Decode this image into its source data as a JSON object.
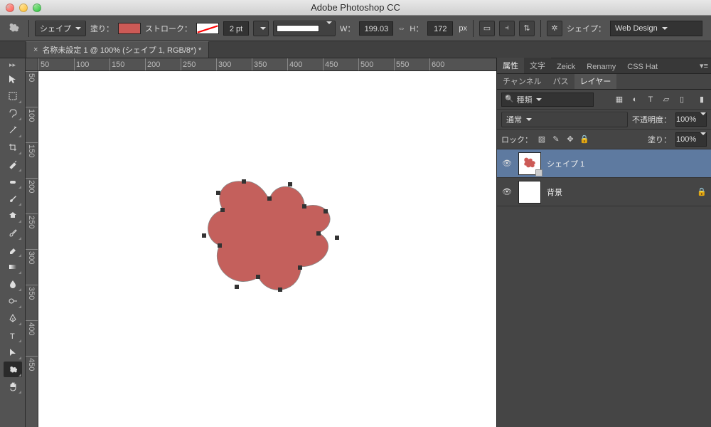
{
  "app_title": "Adobe Photoshop CC",
  "optbar": {
    "tool_mode": "シェイプ",
    "fill_label": "塗り：",
    "stroke_label": "ストローク：",
    "stroke_width": "2 pt",
    "w_label": "W：",
    "w_value": "199.03",
    "h_label": "H：",
    "h_value": "172",
    "h_unit": "px",
    "shape_label": "シェイプ：",
    "workspace": "Web Design"
  },
  "doc_tab": "名称未設定 1 @ 100% (シェイプ 1, RGB/8*) *",
  "ruler_h": [
    "50",
    "100",
    "150",
    "200",
    "250",
    "300",
    "350",
    "400",
    "450",
    "500",
    "550",
    "600"
  ],
  "ruler_v": [
    "50",
    "100",
    "150",
    "200",
    "250",
    "300",
    "350",
    "400",
    "450"
  ],
  "panel_tabs": [
    "属性",
    "文字",
    "Zeick",
    "Renamy",
    "CSS Hat"
  ],
  "sub_tabs": [
    "チャンネル",
    "パス",
    "レイヤー"
  ],
  "filter_label": "種類",
  "blend_mode": "通常",
  "opacity_label": "不透明度：",
  "opacity_value": "100%",
  "lock_label": "ロック：",
  "fill_op_label": "塗り：",
  "fill_op_value": "100%",
  "layers": [
    {
      "name": "シェイプ 1",
      "selected": true,
      "thumb": "shape",
      "locked": false
    },
    {
      "name": "背景",
      "selected": false,
      "thumb": "white",
      "locked": true
    }
  ],
  "colors": {
    "accent": "#cc5a56"
  }
}
